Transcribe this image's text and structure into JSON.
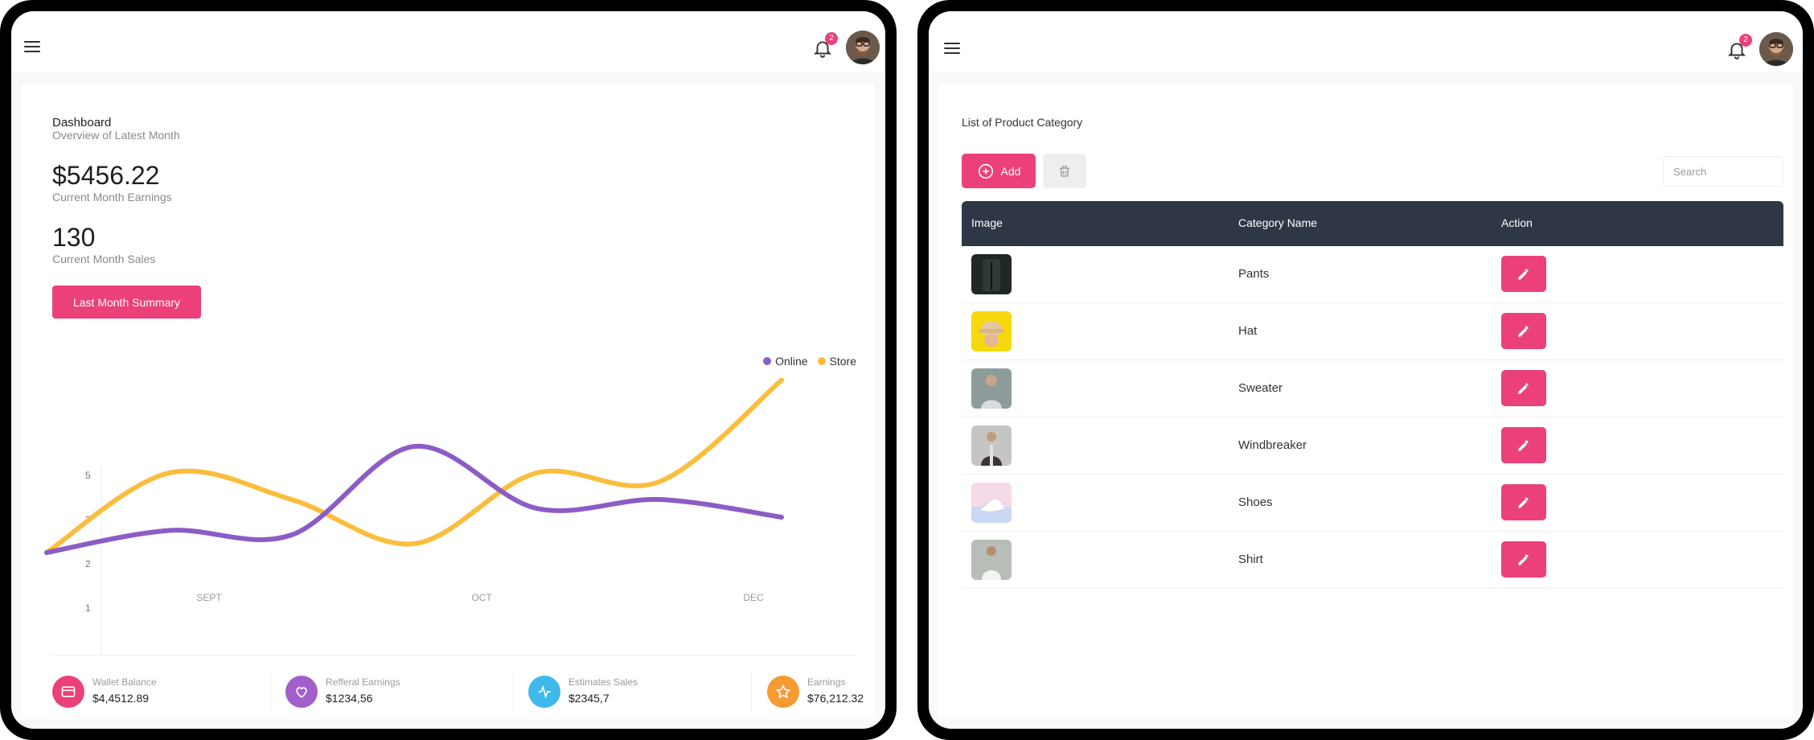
{
  "colors": {
    "accent": "#ec407a",
    "online": "#8c5cc6",
    "store": "#fbbd3b",
    "header_dark": "#2f3747"
  },
  "left": {
    "notification_count": "2",
    "dashboard": {
      "title": "Dashboard",
      "subtitle": "Overview of Latest Month",
      "earnings_value": "$5456.22",
      "earnings_label": "Current Month Earnings",
      "sales_value": "130",
      "sales_label": "Current Month Sales",
      "summary_button": "Last Month Summary"
    },
    "legend": {
      "online": "Online",
      "store": "Store"
    },
    "stats": [
      {
        "label": "Wallet Balance",
        "value": "$4,4512.89",
        "icon": "credit-card-icon",
        "color": "#ec407a"
      },
      {
        "label": "Refferal Earnings",
        "value": "$1234,56",
        "icon": "heart-icon",
        "color": "#a25fc9"
      },
      {
        "label": "Estimates Sales",
        "value": "$2345,7",
        "icon": "activity-icon",
        "color": "#3fb8ea"
      },
      {
        "label": "Earnings",
        "value": "$76,212.32",
        "icon": "star-icon",
        "color": "#f79a32"
      }
    ]
  },
  "chart_data": {
    "type": "line",
    "x": [
      "SEPT",
      "",
      "OCT",
      "",
      "DEC",
      ""
    ],
    "x_tick_labels": [
      "SEPT",
      "OCT",
      "DEC"
    ],
    "y_ticks": [
      1,
      2,
      3,
      5
    ],
    "series": [
      {
        "name": "Online",
        "values": [
          1,
          1.5,
          1.4,
          3.4,
          2,
          2.2,
          1.8
        ]
      },
      {
        "name": "Store",
        "values": [
          1,
          2.8,
          2.2,
          1.2,
          2.8,
          2.6,
          4.9
        ]
      }
    ],
    "legend": "top-right",
    "grid": false
  },
  "right": {
    "notification_count": "2",
    "title": "List of Product Category",
    "add_label": "Add",
    "search_placeholder": "Search",
    "table": {
      "headers": [
        "Image",
        "Category Name",
        "Action"
      ],
      "rows": [
        {
          "name": "Pants"
        },
        {
          "name": "Hat"
        },
        {
          "name": "Sweater"
        },
        {
          "name": "Windbreaker"
        },
        {
          "name": "Shoes"
        },
        {
          "name": "Shirt"
        }
      ]
    }
  }
}
